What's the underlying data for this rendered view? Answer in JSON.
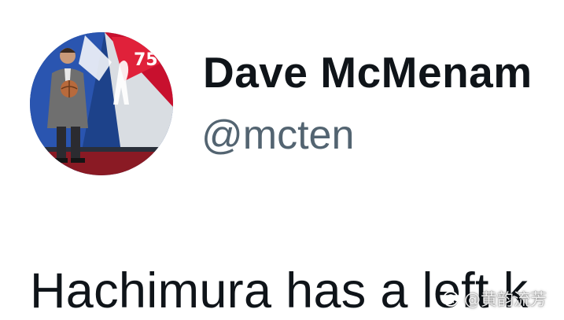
{
  "profile": {
    "display_name": "Dave McMenam",
    "handle": "@mcten"
  },
  "tweet": {
    "text": "Hachimura has a left k"
  },
  "avatar": {
    "logo_text": "75"
  },
  "watermark": {
    "text": "@黄韵流芳"
  },
  "colors": {
    "name": "#0f1419",
    "handle": "#536471",
    "background": "#ffffff",
    "logo_blue": "#1d428a",
    "logo_red": "#c8102e"
  }
}
